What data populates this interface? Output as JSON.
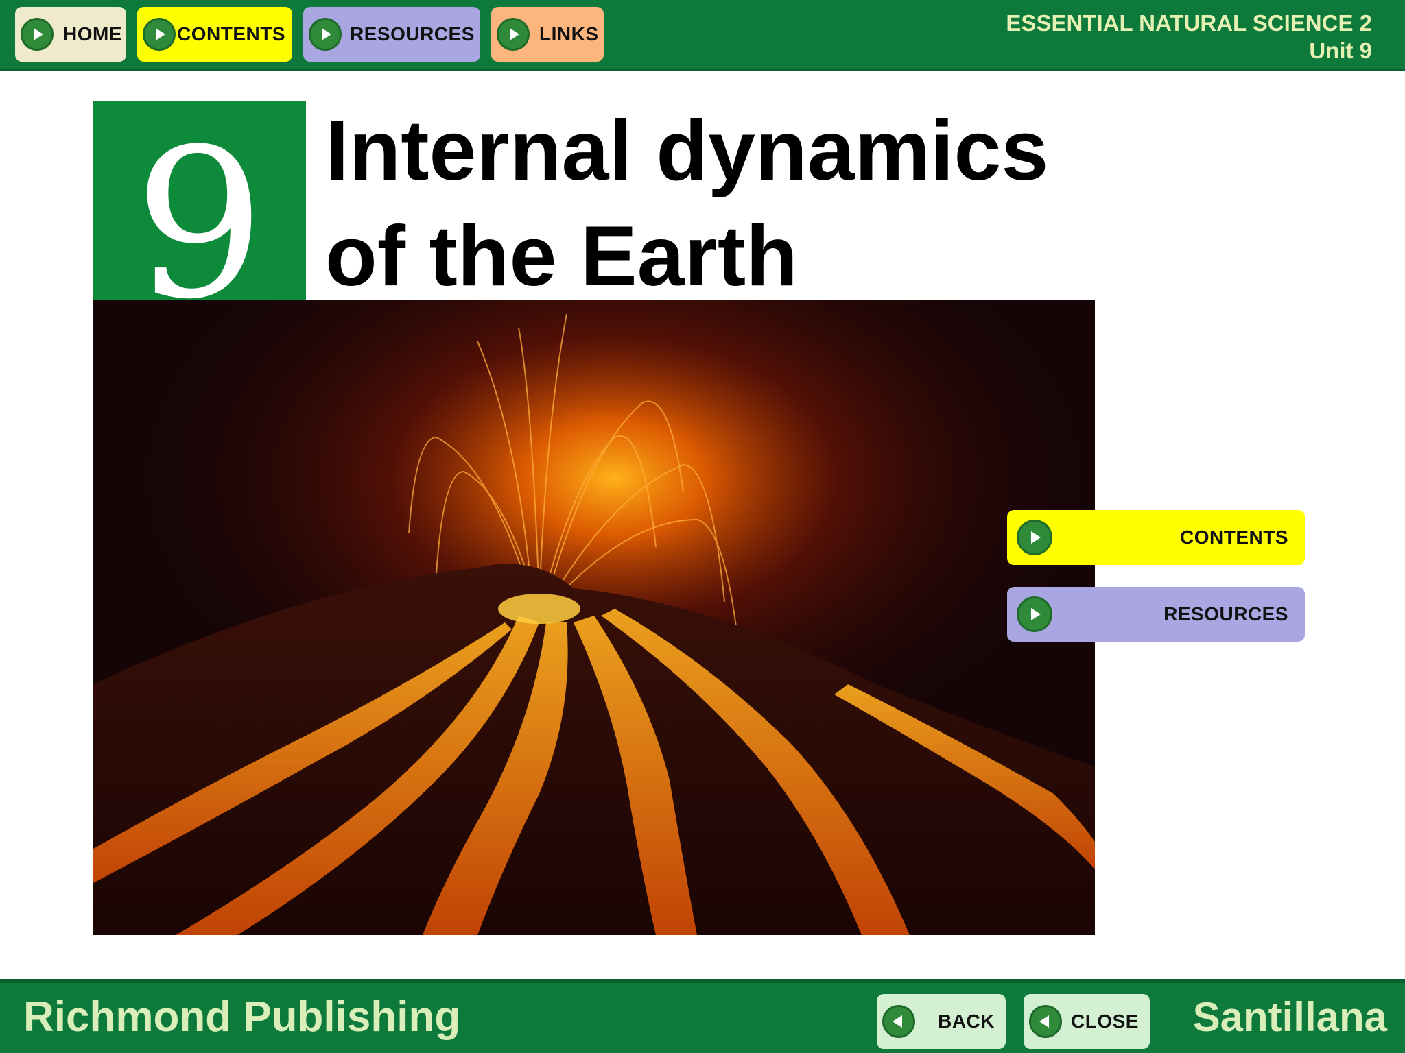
{
  "nav": {
    "items": [
      {
        "label": "HOME",
        "color": "#eeeacb"
      },
      {
        "label": "CONTENTS",
        "color": "#ffff00"
      },
      {
        "label": "RESOURCES",
        "color": "#a9a6e2"
      },
      {
        "label": "LINKS",
        "color": "#fbb57d"
      }
    ]
  },
  "header": {
    "course": "ESSENTIAL NATURAL SCIENCE 2",
    "unit": "Unit 9"
  },
  "chapter": {
    "number": "9",
    "title_line1": "Internal dynamics",
    "title_line2": "of the Earth"
  },
  "side_buttons": {
    "contents": "CONTENTS",
    "resources": "RESOURCES"
  },
  "footer": {
    "publisher": "Richmond Publishing",
    "brand": "Santillana",
    "back": "BACK",
    "close": "CLOSE"
  },
  "colors": {
    "header_green": "#0d7a3c",
    "chapter_green": "#0e8a3b",
    "icon_green": "#2f8a3a",
    "contents_yellow": "#ffff00",
    "resources_purple": "#a9a6e2"
  }
}
